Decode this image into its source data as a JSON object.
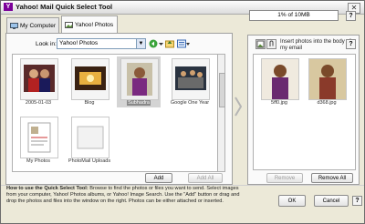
{
  "window": {
    "title": "Yahoo! Mail Quick Select Tool",
    "close_glyph": "✕",
    "icon_letter": "Y"
  },
  "tabs": [
    {
      "label": "My Computer",
      "icon": "computer-icon",
      "active": false
    },
    {
      "label": "Yahoo! Photos",
      "icon": "photos-icon",
      "active": true
    }
  ],
  "toolbar": {
    "look_in_label": "Look in:",
    "look_in_value": "Yahoo! Photos"
  },
  "thumbnails": [
    {
      "label": "2005-01-03",
      "selected": false
    },
    {
      "label": "Blog",
      "selected": false
    },
    {
      "label": "Subhadra",
      "selected": true
    },
    {
      "label": "Google One Year",
      "selected": false
    },
    {
      "label": "My Photos",
      "selected": false
    },
    {
      "label": "PhotoMail Uploads",
      "selected": false
    }
  ],
  "left_buttons": {
    "add": "Add",
    "add_all": "Add All"
  },
  "right": {
    "size_indicator": "1% of 10MB",
    "insert_text": "Insert photos into the body of my email",
    "files": [
      {
        "label": "5ff0.jpg"
      },
      {
        "label": "d368.jpg"
      }
    ],
    "remove": "Remove",
    "remove_all": "Remove All"
  },
  "help_glyph": "?",
  "howto": {
    "heading": "How to use the Quick Select Tool:",
    "body": "Browse to find the photos or files you want to send. Select images from your computer, Yahoo! Photos albums, or Yahoo! Image Search. Use the \"Add\" button or drag and drop the photos and files into the window on the right. Photos can be either attached or inserted."
  },
  "footer": {
    "ok": "OK",
    "cancel": "Cancel"
  }
}
